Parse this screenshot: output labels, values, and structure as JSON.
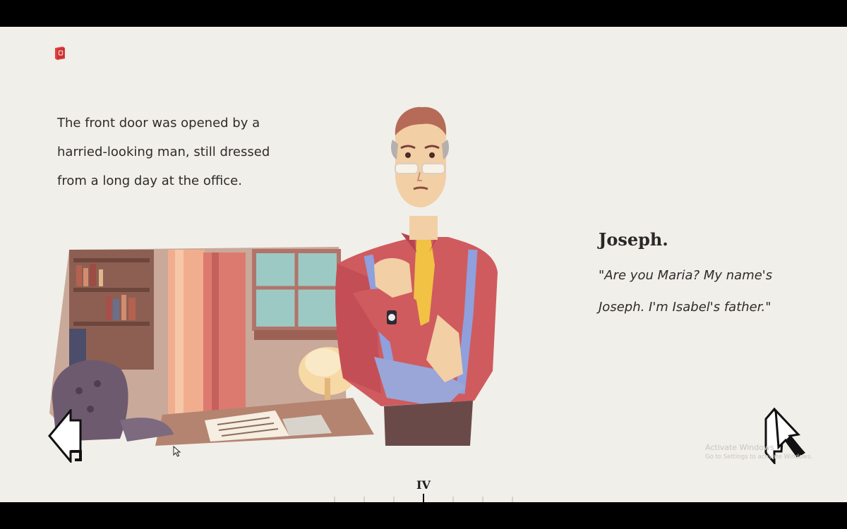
{
  "narration": {
    "lines": [
      "The front door was opened by a",
      "harried-looking man, still dressed",
      "from a long day at the office."
    ]
  },
  "dialogue": {
    "speaker": "Joseph.",
    "lines": [
      "\"Are you Maria? My name's",
      "Joseph. I'm Isabel's father.\""
    ]
  },
  "chapter": {
    "numeral": "IV"
  },
  "icons": {
    "journal": "book-icon",
    "previous": "arrow-left-icon",
    "next": "arrow-right-icon",
    "cursor": "mouse-cursor-icon"
  },
  "watermark": {
    "title": "Activate Windows",
    "subtitle": "Go to Settings to activate Windows."
  },
  "colors": {
    "page_background": "#f1efea",
    "letterbox": "#000000",
    "text": "#2e2b2a",
    "accent_red": "#e0413f"
  }
}
